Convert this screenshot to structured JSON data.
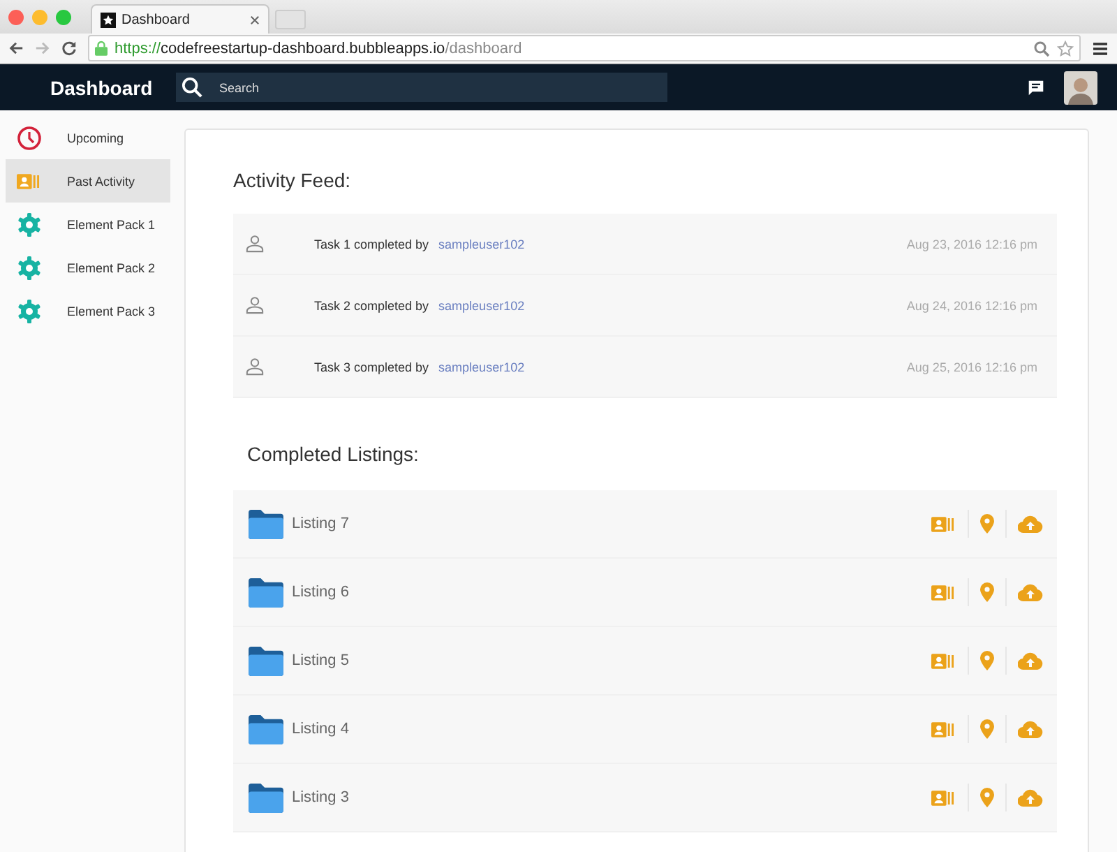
{
  "browser": {
    "tab_title": "Dashboard",
    "url_scheme": "https://",
    "url_host": "codefreestartup-dashboard.bubbleapps.io",
    "url_path": "/dashboard"
  },
  "header": {
    "title": "Dashboard",
    "search": {
      "placeholder": "Search"
    }
  },
  "sidebar": {
    "items": [
      {
        "label": "Upcoming",
        "kind": "clock",
        "selected": false
      },
      {
        "label": "Past Activity",
        "kind": "contacts",
        "selected": true
      },
      {
        "label": "Element Pack 1",
        "kind": "gear",
        "selected": false
      },
      {
        "label": "Element Pack 2",
        "kind": "gear",
        "selected": false
      },
      {
        "label": "Element Pack 3",
        "kind": "gear",
        "selected": false
      }
    ]
  },
  "activity_feed": {
    "title": "Activity Feed:",
    "items": [
      {
        "text": "Task 1 completed by",
        "user": "sampleuser102",
        "time": "Aug 23, 2016 12:16 pm"
      },
      {
        "text": "Task 2 completed by",
        "user": "sampleuser102",
        "time": "Aug 24, 2016 12:16 pm"
      },
      {
        "text": "Task 3 completed by",
        "user": "sampleuser102",
        "time": "Aug 25, 2016 12:16 pm"
      }
    ]
  },
  "completed_listings": {
    "title": "Completed Listings:",
    "items": [
      {
        "name": "Listing 7"
      },
      {
        "name": "Listing 6"
      },
      {
        "name": "Listing 5"
      },
      {
        "name": "Listing 4"
      },
      {
        "name": "Listing 3"
      }
    ]
  }
}
